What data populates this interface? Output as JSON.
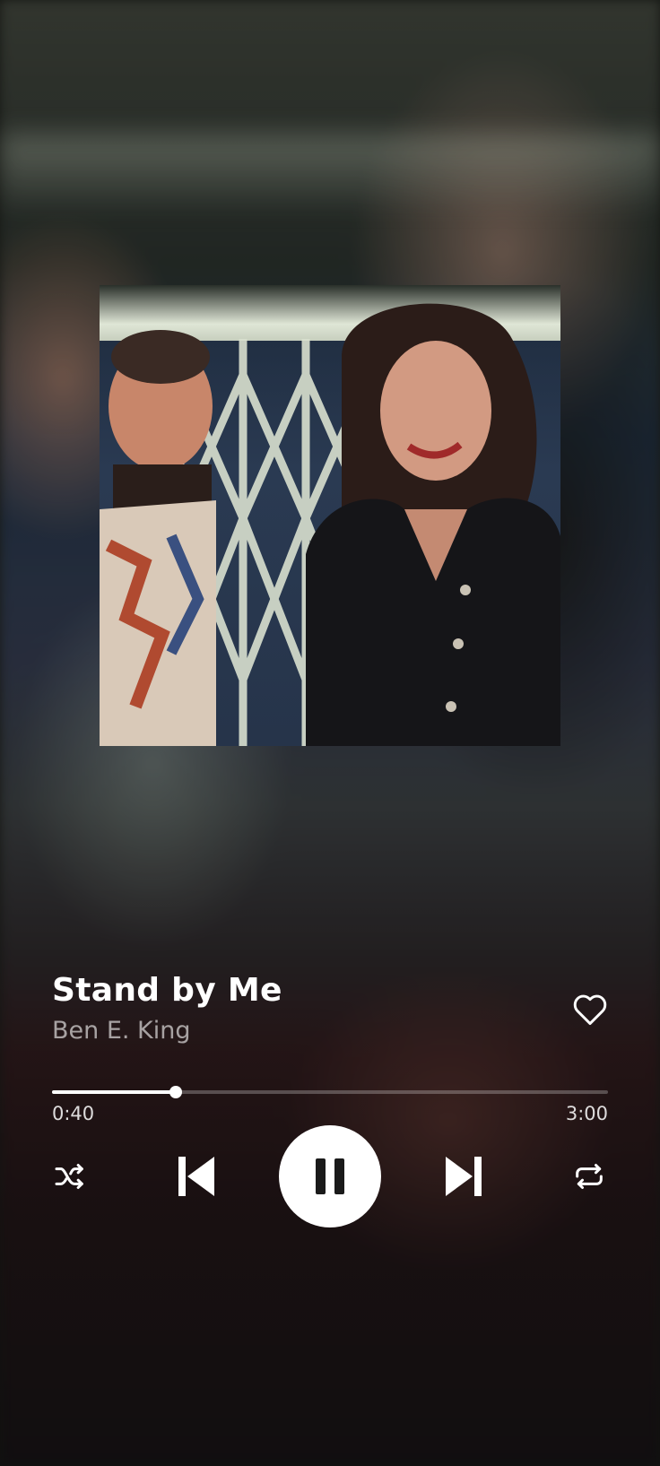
{
  "track": {
    "title": "Stand by Me",
    "artist": "Ben E. King"
  },
  "playback": {
    "elapsed": "0:40",
    "total": "3:00",
    "progress_fraction": 0.222,
    "state": "playing"
  },
  "icons": {
    "like": "heart-outline-icon",
    "shuffle": "shuffle-icon",
    "previous": "skip-previous-icon",
    "play_pause": "pause-icon",
    "next": "skip-next-icon",
    "repeat": "repeat-icon"
  },
  "colors": {
    "text_primary": "#ffffff",
    "text_secondary": "#a9a9a9",
    "accent": "#ffffff"
  }
}
